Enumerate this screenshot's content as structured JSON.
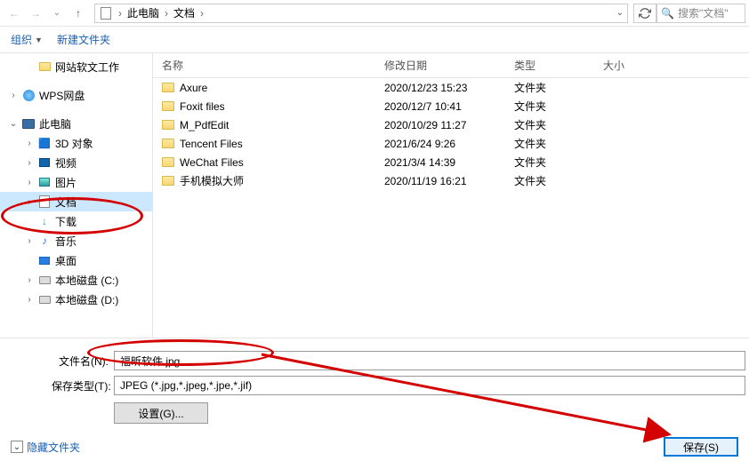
{
  "nav": {
    "breadcrumb": [
      "此电脑",
      "文档"
    ],
    "search_placeholder": "搜索\"文档\""
  },
  "toolbar": {
    "organize": "组织",
    "new_folder": "新建文件夹"
  },
  "sidebar": {
    "items": [
      {
        "label": "网站软文工作",
        "kind": "folder",
        "indent": true,
        "arrow": ""
      },
      {
        "label": "WPS网盘",
        "kind": "wps",
        "indent": false,
        "arrow": "›"
      },
      {
        "label": "此电脑",
        "kind": "monitor",
        "indent": false,
        "arrow": "⌄"
      },
      {
        "label": "3D 对象",
        "kind": "3d",
        "indent": true,
        "arrow": "›"
      },
      {
        "label": "视频",
        "kind": "video",
        "indent": true,
        "arrow": "›"
      },
      {
        "label": "图片",
        "kind": "pic",
        "indent": true,
        "arrow": "›"
      },
      {
        "label": "文档",
        "kind": "doc",
        "indent": true,
        "arrow": "›",
        "selected": true
      },
      {
        "label": "下载",
        "kind": "down",
        "indent": true,
        "arrow": ""
      },
      {
        "label": "音乐",
        "kind": "music",
        "indent": true,
        "arrow": "›"
      },
      {
        "label": "桌面",
        "kind": "desk",
        "indent": true,
        "arrow": ""
      },
      {
        "label": "本地磁盘 (C:)",
        "kind": "disk",
        "indent": true,
        "arrow": "›"
      },
      {
        "label": "本地磁盘 (D:)",
        "kind": "disk",
        "indent": true,
        "arrow": "›"
      }
    ]
  },
  "list": {
    "headers": {
      "name": "名称",
      "date": "修改日期",
      "type": "类型",
      "size": "大小"
    },
    "rows": [
      {
        "name": "Axure",
        "date": "2020/12/23 15:23",
        "type": "文件夹"
      },
      {
        "name": "Foxit files",
        "date": "2020/12/7 10:41",
        "type": "文件夹"
      },
      {
        "name": "M_PdfEdit",
        "date": "2020/10/29 11:27",
        "type": "文件夹"
      },
      {
        "name": "Tencent Files",
        "date": "2021/6/24 9:26",
        "type": "文件夹"
      },
      {
        "name": "WeChat Files",
        "date": "2021/3/4 14:39",
        "type": "文件夹"
      },
      {
        "name": "手机模拟大师",
        "date": "2020/11/19 16:21",
        "type": "文件夹"
      }
    ]
  },
  "bottom": {
    "filename_label": "文件名(N):",
    "filename_value": "福昕软件.jpg",
    "type_label": "保存类型(T):",
    "type_value": "JPEG (*.jpg,*.jpeg,*.jpe,*.jif)",
    "settings_label": "设置(G)..."
  },
  "footer": {
    "hide_folders": "隐藏文件夹",
    "save": "保存(S)"
  }
}
